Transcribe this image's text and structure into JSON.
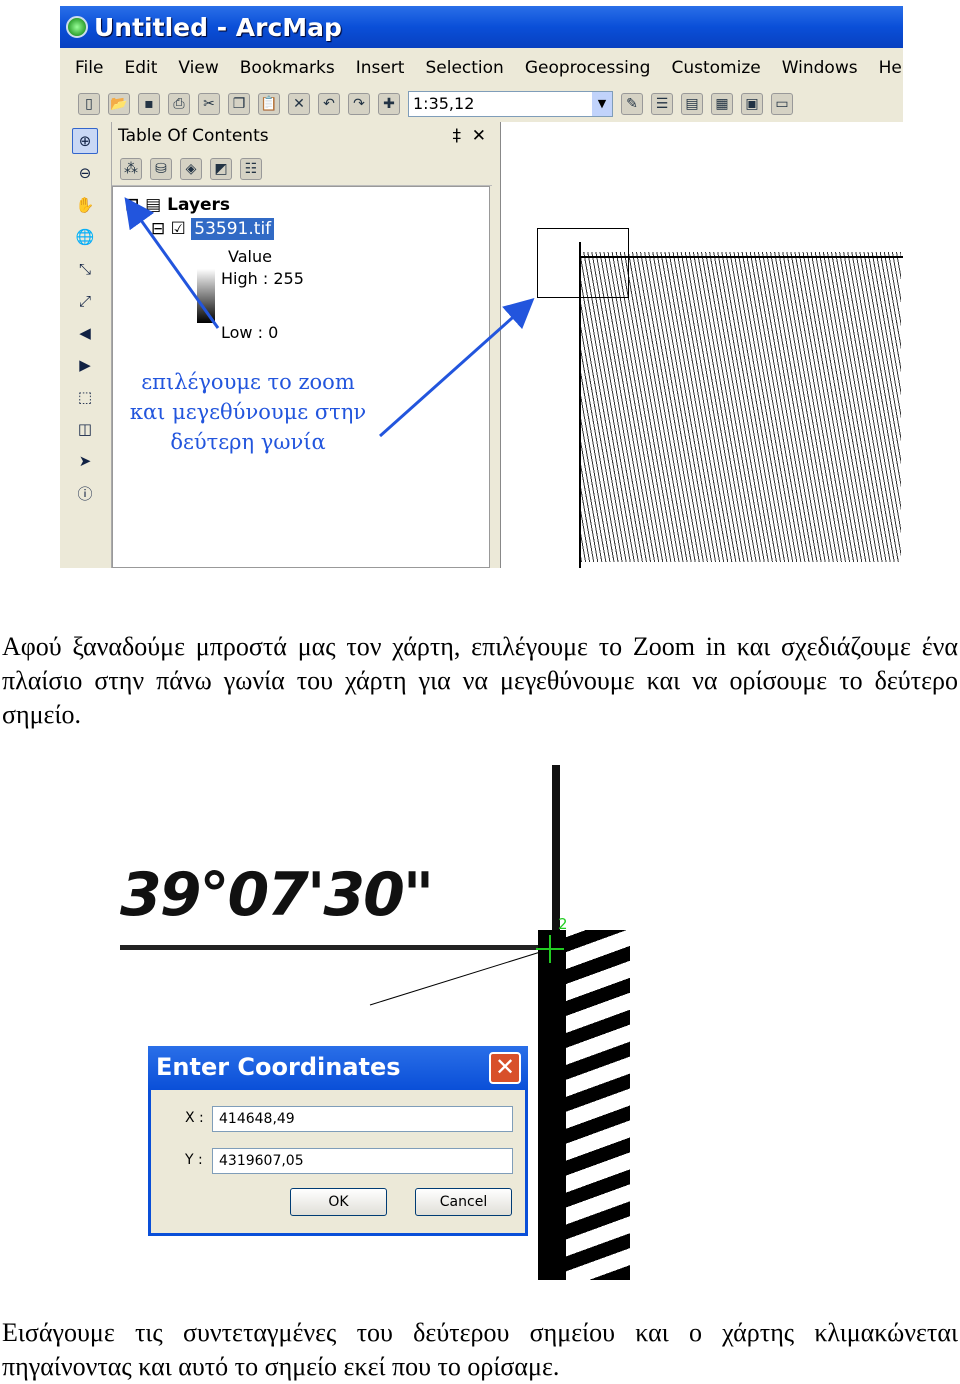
{
  "arcmap": {
    "title": "Untitled - ArcMap",
    "menu": [
      "File",
      "Edit",
      "View",
      "Bookmarks",
      "Insert",
      "Selection",
      "Geoprocessing",
      "Customize",
      "Windows",
      "Help"
    ],
    "scale": "1:35,12",
    "toc": {
      "title": "Table Of Contents",
      "pin": "‡",
      "close": "✕",
      "layers": "Layers",
      "layer": "53591.tif",
      "value": "Value",
      "high": "High : 255",
      "low": "Low : 0"
    },
    "annotation": [
      "επιλέγουμε το zoom",
      "και μεγεθύνουμε στην",
      "δεύτερη γωνία"
    ],
    "accent": "#0a4fd8",
    "annotation_color": "#2255dd"
  },
  "paragraph1": "Αφού ξαναδούμε μπροστά μας τον χάρτη, επιλέγουμε το Zoom in και σχεδιάζουμε ένα πλαίσιο στην πάνω γωνία του χάρτη για να μεγεθύνουμε και να ορίσουμε το δεύτερο σημείο.",
  "map_label": "39°07'30\"",
  "point_label": "2",
  "dialog": {
    "title": "Enter Coordinates",
    "x_label": "X :",
    "y_label": "Y :",
    "x_value": "414648,49",
    "y_value": "4319607,05",
    "ok": "OK",
    "cancel": "Cancel"
  },
  "paragraph2": "Εισάγουμε τις συντεταγμένες του δεύτερου σημείου και ο χάρτης κλιμακώνεται πηγαίνοντας και αυτό το σημείο εκεί που το ορίσαμε."
}
